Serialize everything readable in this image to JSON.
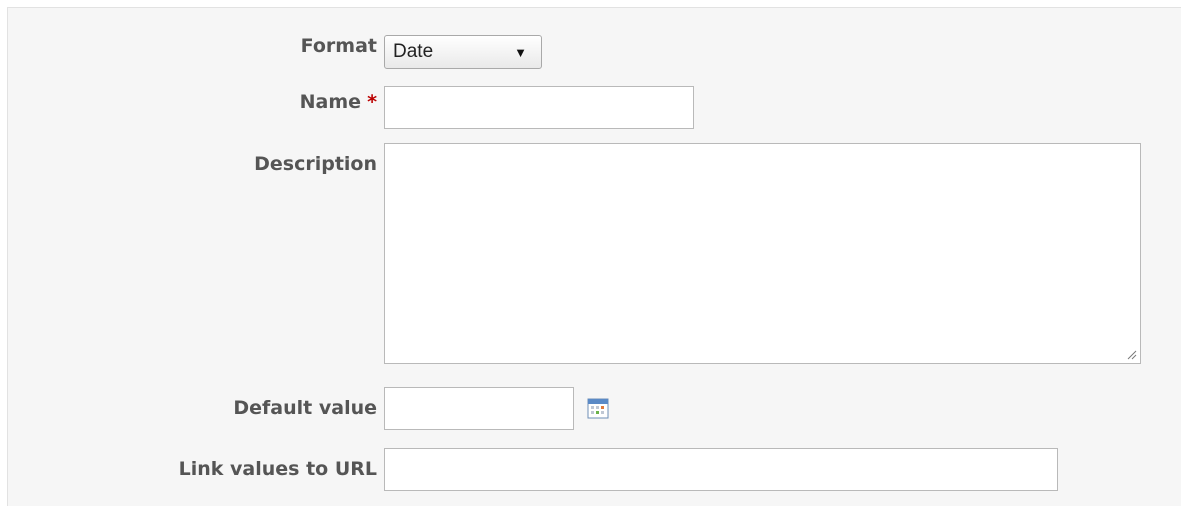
{
  "form": {
    "format": {
      "label": "Format",
      "selected": "Date"
    },
    "name": {
      "label": "Name",
      "required_mark": "*",
      "value": ""
    },
    "description": {
      "label": "Description",
      "value": ""
    },
    "default_value": {
      "label": "Default value",
      "value": "",
      "picker_icon": "calendar-icon"
    },
    "link_values": {
      "label": "Link values to URL",
      "value": ""
    }
  }
}
